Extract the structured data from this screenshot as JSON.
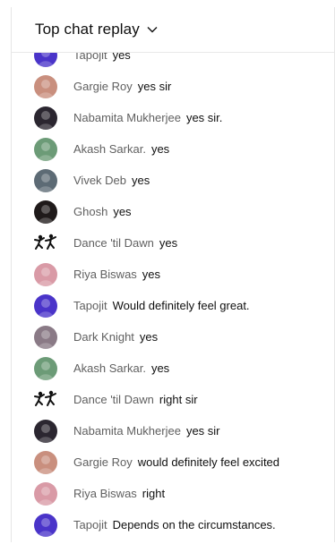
{
  "header": {
    "title": "Top chat replay"
  },
  "messages": [
    {
      "author": "Tapojit",
      "text": "yes",
      "avatar": "#4a34c9",
      "icon": "avatar-icon"
    },
    {
      "author": "Gargie Roy",
      "text": "yes sir",
      "avatar": "#c98f7e",
      "icon": "avatar-icon"
    },
    {
      "author": "Nabamita Mukherjee",
      "text": "yes sir.",
      "avatar": "#2b2630",
      "icon": "avatar-icon"
    },
    {
      "author": "Akash Sarkar.",
      "text": "yes",
      "avatar": "#6c9b77",
      "icon": "avatar-icon"
    },
    {
      "author": "Vivek Deb",
      "text": "yes",
      "avatar": "#5d6b75",
      "icon": "avatar-icon"
    },
    {
      "author": "Ghosh",
      "text": "yes",
      "avatar": "#1f1a1a",
      "icon": "avatar-icon"
    },
    {
      "author": "Dance 'til Dawn",
      "text": "yes",
      "avatar": "#ffffff",
      "icon": "dancers-icon"
    },
    {
      "author": "Riya Biswas",
      "text": "yes",
      "avatar": "#d99aa6",
      "icon": "avatar-icon"
    },
    {
      "author": "Tapojit",
      "text": "Would definitely feel great.",
      "avatar": "#4a34c9",
      "icon": "avatar-icon"
    },
    {
      "author": "Dark Knight",
      "text": "yes",
      "avatar": "#8a7a86",
      "icon": "avatar-icon"
    },
    {
      "author": "Akash Sarkar.",
      "text": "yes",
      "avatar": "#6c9b77",
      "icon": "avatar-icon"
    },
    {
      "author": "Dance 'til Dawn",
      "text": "right sir",
      "avatar": "#ffffff",
      "icon": "dancers-icon"
    },
    {
      "author": "Nabamita Mukherjee",
      "text": "yes sir",
      "avatar": "#2b2630",
      "icon": "avatar-icon"
    },
    {
      "author": "Gargie Roy",
      "text": "would definitely feel excited",
      "avatar": "#c98f7e",
      "icon": "avatar-icon"
    },
    {
      "author": "Riya Biswas",
      "text": "right",
      "avatar": "#d99aa6",
      "icon": "avatar-icon"
    },
    {
      "author": "Tapojit",
      "text": "Depends on the circumstances.",
      "avatar": "#4a34c9",
      "icon": "avatar-icon"
    }
  ]
}
